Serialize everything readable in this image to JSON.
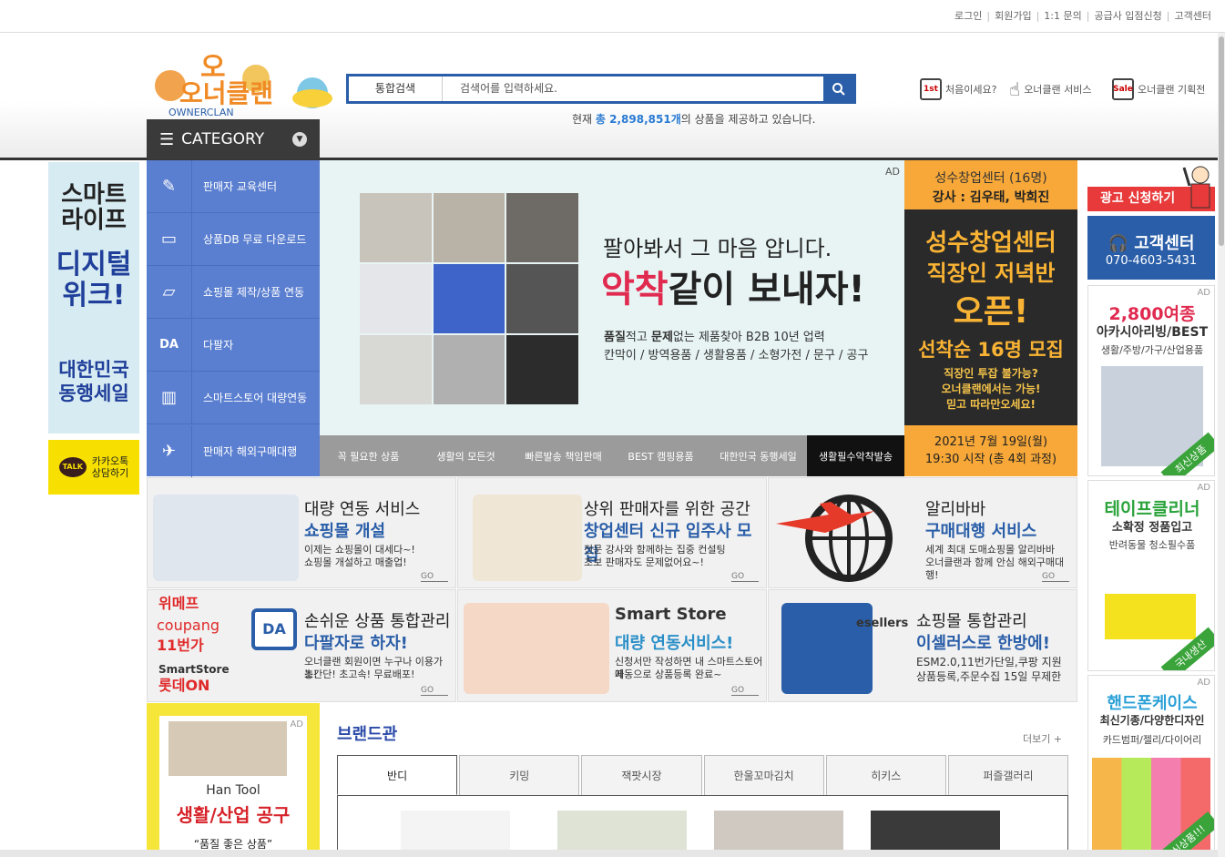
{
  "top_links": [
    "로그인",
    "회원가입",
    "1:1 문의",
    "공급사 입점신청",
    "고객센터"
  ],
  "logo": {
    "text": "오너클랜",
    "sub": "OWNERCLAN"
  },
  "search": {
    "scope": "통합검색",
    "placeholder": "검색어를 입력하세요."
  },
  "product_count": {
    "prefix": "현재 ",
    "highlight": "총 2,898,851개",
    "suffix": "의 상품을 제공하고 있습니다."
  },
  "header_links": [
    {
      "label": "처음이세요?",
      "icon": "1st-icon",
      "badge": "1st"
    },
    {
      "label": "오너클랜 서비스",
      "icon": "hand-pointer-icon"
    },
    {
      "label": "오너클랜 기획전",
      "icon": "gift-sale-icon",
      "badge": "Sale"
    }
  ],
  "category": {
    "label": "CATEGORY"
  },
  "category_items": [
    {
      "label": "판매자 교육센터",
      "icon": "pen-icon",
      "glyph": "✎"
    },
    {
      "label": "상품DB 무료 다운로드",
      "icon": "laptop-icon",
      "glyph": "▭"
    },
    {
      "label": "쇼핑몰 제작/상품 연동",
      "icon": "monitor-icon",
      "glyph": "▱"
    },
    {
      "label": "다팔자",
      "icon": "da-logo-icon",
      "glyph": "DA"
    },
    {
      "label": "스마트스토어 대량연동",
      "icon": "bar-chart-icon",
      "glyph": "▥"
    },
    {
      "label": "판매자 해외구매대행",
      "icon": "airplane-icon",
      "glyph": "✈"
    }
  ],
  "banner": {
    "ad": "AD",
    "line1": "팔아봐서 그 마음 압니다.",
    "line2_red": "악착",
    "line2_rest": "같이 보내자!",
    "line3a": "품질",
    "line3b": "적고 ",
    "line3c": "문제",
    "line3d": "없는 제품찾아 B2B 10년 업력",
    "line4": "칸막이 / 방역용품 / 생활용품 / 소형가전 / 문구 / 공구"
  },
  "banner_tabs": [
    "꼭 필요한 상품",
    "생활의 모든것",
    "빠른발송 책임판매",
    "BEST 캠핑용품",
    "대한민국 동행세일",
    "생활필수악착발송"
  ],
  "seongsu": {
    "t1": "성수창업센터 (16명)",
    "t2": "강사 : 김우태, 박희진",
    "big1": "성수창업센터",
    "big2": "직장인 저녁반",
    "big3": "오픈!",
    "big4": "선착순 16명 모집",
    "sm1": "직장인 투잡 불가능?",
    "sm2": "오너클랜에서는 가능!",
    "sm3": "믿고 따라만오세요!",
    "b1": "2021년 7월 19일(월)",
    "b2": "19:30 시작 (총 4회 과정)"
  },
  "left_banner": {
    "s1a": "스마트",
    "s1b": "라이프",
    "s2a": "디지털",
    "s2b": "위크!",
    "s3a": "대한민국",
    "s3b": "동행세일"
  },
  "kakao": {
    "bubble": "TALK",
    "line1": "카카오톡",
    "line2": "상담하기"
  },
  "right": {
    "ad_apply": "광고 신청하기",
    "cs_title": "고객센터",
    "cs_phone": "070-4603-5431",
    "cards": [
      {
        "ad": "AD",
        "h1": "2,800여종",
        "h2": "아카시아리빙/BEST",
        "s": "생활/주방/가구/산업용품",
        "tag": "최신상품"
      },
      {
        "ad": "AD",
        "h1": "테이프클리너",
        "h2": "소확정 정품입고",
        "s": "반려동물 청소필수품",
        "tag": "국내생산"
      },
      {
        "ad": "AD",
        "h1": "핸드폰케이스",
        "h2": "최신기종/다양한디자인",
        "s": "카드범퍼/젤리/다이어리",
        "tag": "신상품!!!"
      }
    ]
  },
  "services": [
    {
      "h1": "대량 연동 서비스",
      "h2": "쇼핑몰 개설",
      "p1": "이제는 쇼핑몰이 대세다~!",
      "p2": "쇼핑몰 개설하고 매출업!",
      "go": "GO"
    },
    {
      "h1": "상위 판매자를 위한 공간",
      "h2": "창업센터 신규 입주사 모집",
      "p1": "전문 강사와 함께하는 집중 컨설팅",
      "p2": "초보 판매자도 문제없어요~!",
      "go": "GO"
    },
    {
      "h1": "알리바바",
      "h2": "구매대행 서비스",
      "p1": "세계 최대 도매쇼핑몰 알리바바",
      "p2": "오너클랜과 함께 안심 해외구매대행!",
      "go": "GO"
    },
    {
      "h1": "손쉬운 상품 통합관리",
      "h2": "다팔자로 하자!",
      "p1": "오너클랜 회원이면 누구나 이용가능!",
      "p2": "초간단! 초고속! 무료배포!",
      "go": "GO",
      "logos": [
        "위메프",
        "coupang",
        "11번가",
        "SmartStore",
        "롯데ON"
      ]
    },
    {
      "h1": "Smart Store",
      "h2": "대량 연동서비스!",
      "p1": "신청서만 작성하면 내 스마트스토어에",
      "p2": "자동으로 상품등록 완료~",
      "go": "GO"
    },
    {
      "h1": "쇼핑몰 통합관리",
      "h2": "이셀러스로 한방에!",
      "p1": "ESM2.0,11번가단일,쿠팡 지원",
      "p2": "상품등록,주문수집 15일 무제한",
      "go": "GO",
      "logo": "esellers"
    }
  ],
  "hantool": {
    "ad": "AD",
    "t1": "Han Tool",
    "t2": "생활/산업 공구",
    "t3": "“품질 좋은 상품”"
  },
  "brand": {
    "title": "브랜드관",
    "more": "더보기 +",
    "tabs": [
      "반디",
      "키밍",
      "잭팟시장",
      "한울꼬마김치",
      "히키스",
      "퍼즐갤러리"
    ]
  },
  "colors": {
    "primary": "#2a5ea8",
    "category_bg": "#5b7fd0",
    "accent_red": "#e02a4f",
    "seongsu_orange": "#f7a838",
    "kakao_yellow": "#f7e000"
  }
}
